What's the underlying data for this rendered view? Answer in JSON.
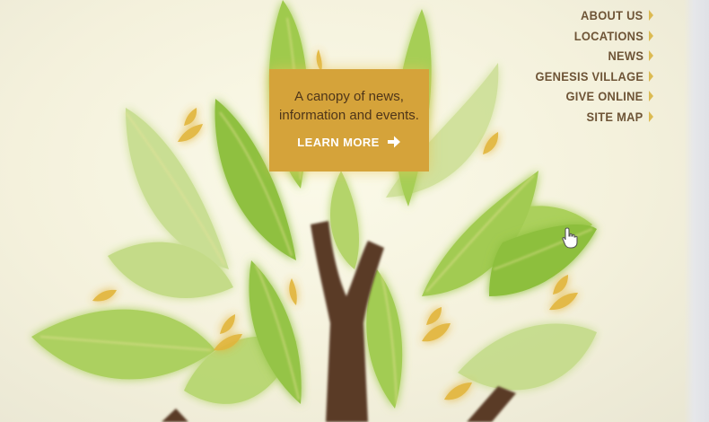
{
  "nav": {
    "items": [
      {
        "label": "ABOUT US"
      },
      {
        "label": "LOCATIONS"
      },
      {
        "label": "NEWS"
      },
      {
        "label": "GENESIS VILLAGE"
      },
      {
        "label": "GIVE ONLINE"
      },
      {
        "label": "SITE MAP"
      }
    ]
  },
  "promo": {
    "line1": "A canopy of news,",
    "line2": "information and events.",
    "cta_label": "LEARN MORE"
  },
  "colors": {
    "background": "#f6f3e3",
    "promo_box": "#d5a33a",
    "nav_text": "#6e5436",
    "nav_arrow": "#d8b23a",
    "leaf_green": "#9cc94a",
    "leaf_light": "#c4dc86",
    "trunk": "#5a3b26",
    "accent_gold": "#e2b53a"
  },
  "icons": {
    "cta_arrow": "arrow-right-icon",
    "nav_arrow": "chevron-right-icon",
    "pointer": "cursor-hand-icon"
  }
}
